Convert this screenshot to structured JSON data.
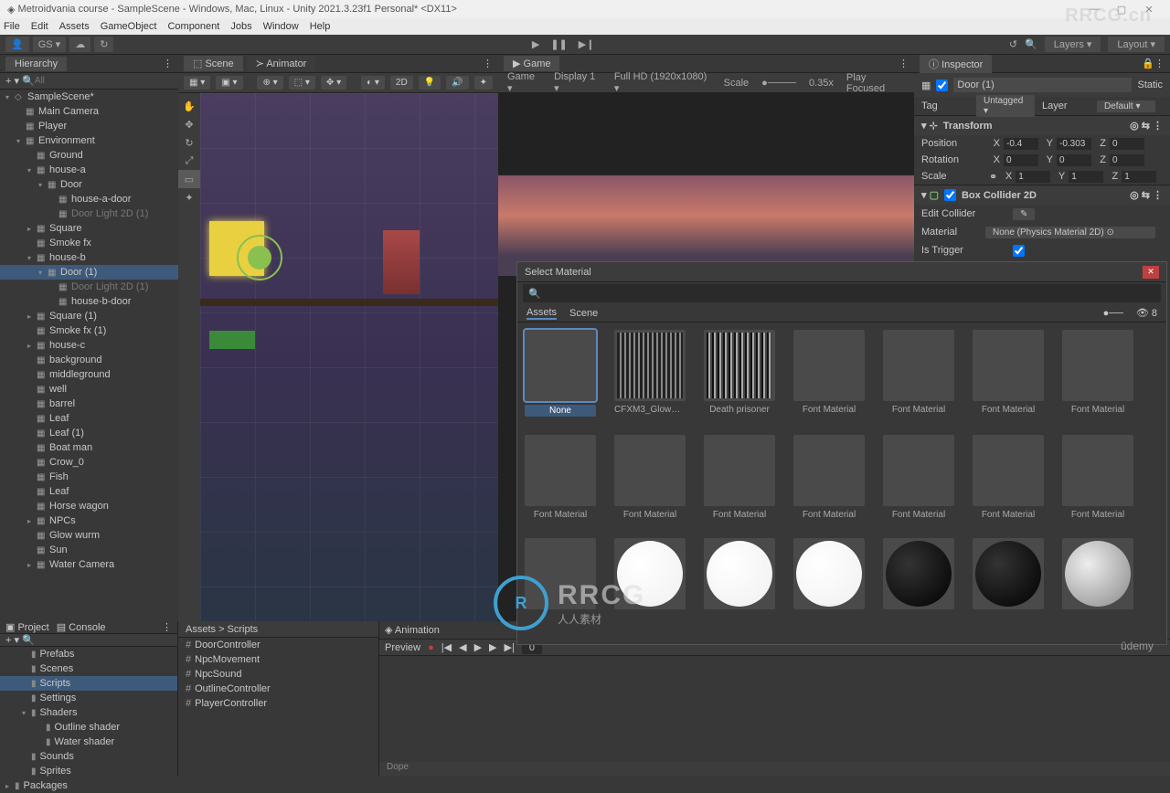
{
  "titlebar": {
    "text": "Metroidvania course - SampleScene - Windows, Mac, Linux - Unity 2021.3.23f1 Personal* <DX11>"
  },
  "menu": [
    "File",
    "Edit",
    "Assets",
    "GameObject",
    "Component",
    "Jobs",
    "Window",
    "Help"
  ],
  "toolbar": {
    "gs": "GS ▾",
    "layers": "Layers",
    "layout": "Layout"
  },
  "hierarchy": {
    "title": "Hierarchy",
    "search_placeholder": "All",
    "items": [
      {
        "d": 0,
        "a": "▾",
        "t": "SampleScene*",
        "ico": "◇"
      },
      {
        "d": 1,
        "a": "",
        "t": "Main Camera",
        "ico": "▦"
      },
      {
        "d": 1,
        "a": "",
        "t": "Player",
        "ico": "▦"
      },
      {
        "d": 1,
        "a": "▾",
        "t": "Environment",
        "ico": "▦"
      },
      {
        "d": 2,
        "a": "",
        "t": "Ground",
        "ico": "▦"
      },
      {
        "d": 2,
        "a": "▾",
        "t": "house-a",
        "ico": "▦"
      },
      {
        "d": 3,
        "a": "▾",
        "t": "Door",
        "ico": "▦"
      },
      {
        "d": 4,
        "a": "",
        "t": "house-a-door",
        "ico": "▦"
      },
      {
        "d": 4,
        "a": "",
        "t": "Door Light 2D (1)",
        "ico": "▦",
        "dim": true
      },
      {
        "d": 2,
        "a": "▸",
        "t": "Square",
        "ico": "▦"
      },
      {
        "d": 2,
        "a": "",
        "t": "Smoke fx",
        "ico": "▦"
      },
      {
        "d": 2,
        "a": "▾",
        "t": "house-b",
        "ico": "▦"
      },
      {
        "d": 3,
        "a": "▾",
        "t": "Door (1)",
        "ico": "▦",
        "sel": true
      },
      {
        "d": 4,
        "a": "",
        "t": "Door Light 2D (1)",
        "ico": "▦",
        "dim": true
      },
      {
        "d": 4,
        "a": "",
        "t": "house-b-door",
        "ico": "▦"
      },
      {
        "d": 2,
        "a": "▸",
        "t": "Square (1)",
        "ico": "▦"
      },
      {
        "d": 2,
        "a": "",
        "t": "Smoke fx (1)",
        "ico": "▦"
      },
      {
        "d": 2,
        "a": "▸",
        "t": "house-c",
        "ico": "▦"
      },
      {
        "d": 2,
        "a": "",
        "t": "background",
        "ico": "▦"
      },
      {
        "d": 2,
        "a": "",
        "t": "middleground",
        "ico": "▦"
      },
      {
        "d": 2,
        "a": "",
        "t": "well",
        "ico": "▦"
      },
      {
        "d": 2,
        "a": "",
        "t": "barrel",
        "ico": "▦"
      },
      {
        "d": 2,
        "a": "",
        "t": "Leaf",
        "ico": "▦"
      },
      {
        "d": 2,
        "a": "",
        "t": "Leaf (1)",
        "ico": "▦"
      },
      {
        "d": 2,
        "a": "",
        "t": "Boat man",
        "ico": "▦"
      },
      {
        "d": 2,
        "a": "",
        "t": "Crow_0",
        "ico": "▦"
      },
      {
        "d": 2,
        "a": "",
        "t": "Fish",
        "ico": "▦"
      },
      {
        "d": 2,
        "a": "",
        "t": "Leaf",
        "ico": "▦"
      },
      {
        "d": 2,
        "a": "",
        "t": "Horse wagon",
        "ico": "▦"
      },
      {
        "d": 2,
        "a": "▸",
        "t": "NPCs",
        "ico": "▦"
      },
      {
        "d": 2,
        "a": "",
        "t": "Glow wurm",
        "ico": "▦"
      },
      {
        "d": 2,
        "a": "",
        "t": "Sun",
        "ico": "▦"
      },
      {
        "d": 2,
        "a": "▸",
        "t": "Water Camera",
        "ico": "▦"
      }
    ]
  },
  "scene": {
    "tab": "Scene",
    "tab2": "Animator",
    "btn2d": "2D"
  },
  "game": {
    "tab": "Game",
    "dd_game": "Game",
    "display": "Display 1",
    "res": "Full HD (1920x1080)",
    "scale_lbl": "Scale",
    "scale_val": "0.35x",
    "play": "Play Focused"
  },
  "inspector": {
    "title": "Inspector",
    "obj_name": "Door (1)",
    "static": "Static",
    "tag_lbl": "Tag",
    "tag_val": "Untagged",
    "layer_lbl": "Layer",
    "layer_val": "Default",
    "transform": {
      "title": "Transform",
      "pos_lbl": "Position",
      "px": "-0.4",
      "py": "-0.303",
      "pz": "0",
      "rot_lbl": "Rotation",
      "rx": "0",
      "ry": "0",
      "rz": "0",
      "scl_lbl": "Scale",
      "sx": "1",
      "sy": "1",
      "sz": "1"
    },
    "box": {
      "title": "Box Collider 2D",
      "edit": "Edit Collider",
      "mat_lbl": "Material",
      "mat_val": "None (Physics Material 2D)",
      "trigger_lbl": "Is Trigger"
    }
  },
  "project": {
    "tab1": "Project",
    "tab2": "Console",
    "folders": [
      {
        "t": "Prefabs",
        "a": ""
      },
      {
        "t": "Scenes",
        "a": ""
      },
      {
        "t": "Scripts",
        "a": "",
        "sel": true
      },
      {
        "t": "Settings",
        "a": ""
      },
      {
        "t": "Shaders",
        "a": "▾"
      },
      {
        "t": "Outline shader",
        "a": "",
        "sub": true
      },
      {
        "t": "Water shader",
        "a": "",
        "sub": true
      },
      {
        "t": "Sounds",
        "a": ""
      },
      {
        "t": "Sprites",
        "a": ""
      },
      {
        "t": "Packages",
        "a": "▸",
        "root": true
      }
    ],
    "crumb": "Assets > Scripts",
    "files": [
      "DoorController",
      "NpcMovement",
      "NpcSound",
      "OutlineController",
      "PlayerController"
    ]
  },
  "animation": {
    "title": "Animation",
    "preview": "Preview",
    "frame": "0",
    "dope": "Dope"
  },
  "modal": {
    "title": "Select Material",
    "tabs": [
      "Assets",
      "Scene"
    ],
    "items": [
      {
        "label": "None",
        "sel": true,
        "kind": "empty"
      },
      {
        "label": "CFXM3_GlowDot ...",
        "kind": "tex"
      },
      {
        "label": "Death prisoner",
        "kind": "tex2"
      },
      {
        "label": "Font Material",
        "kind": "empty"
      },
      {
        "label": "Font Material",
        "kind": "empty"
      },
      {
        "label": "Font Material",
        "kind": "empty"
      },
      {
        "label": "Font Material",
        "kind": "empty"
      },
      {
        "label": "Font Material",
        "kind": "empty"
      },
      {
        "label": "Font Material",
        "kind": "empty"
      },
      {
        "label": "Font Material",
        "kind": "empty"
      },
      {
        "label": "Font Material",
        "kind": "empty"
      },
      {
        "label": "Font Material",
        "kind": "empty"
      },
      {
        "label": "Font Material",
        "kind": "empty"
      },
      {
        "label": "Font Material",
        "kind": "empty"
      },
      {
        "label": "",
        "kind": "empty"
      },
      {
        "label": "",
        "kind": "white"
      },
      {
        "label": "",
        "kind": "white"
      },
      {
        "label": "",
        "kind": "white"
      },
      {
        "label": "",
        "kind": "black"
      },
      {
        "label": "",
        "kind": "black"
      },
      {
        "label": "",
        "kind": "gray"
      }
    ]
  },
  "watermarks": {
    "top": "RRCG.cn",
    "big": "RRCG",
    "sub": "人人素材",
    "udemy": "ûdemy"
  }
}
